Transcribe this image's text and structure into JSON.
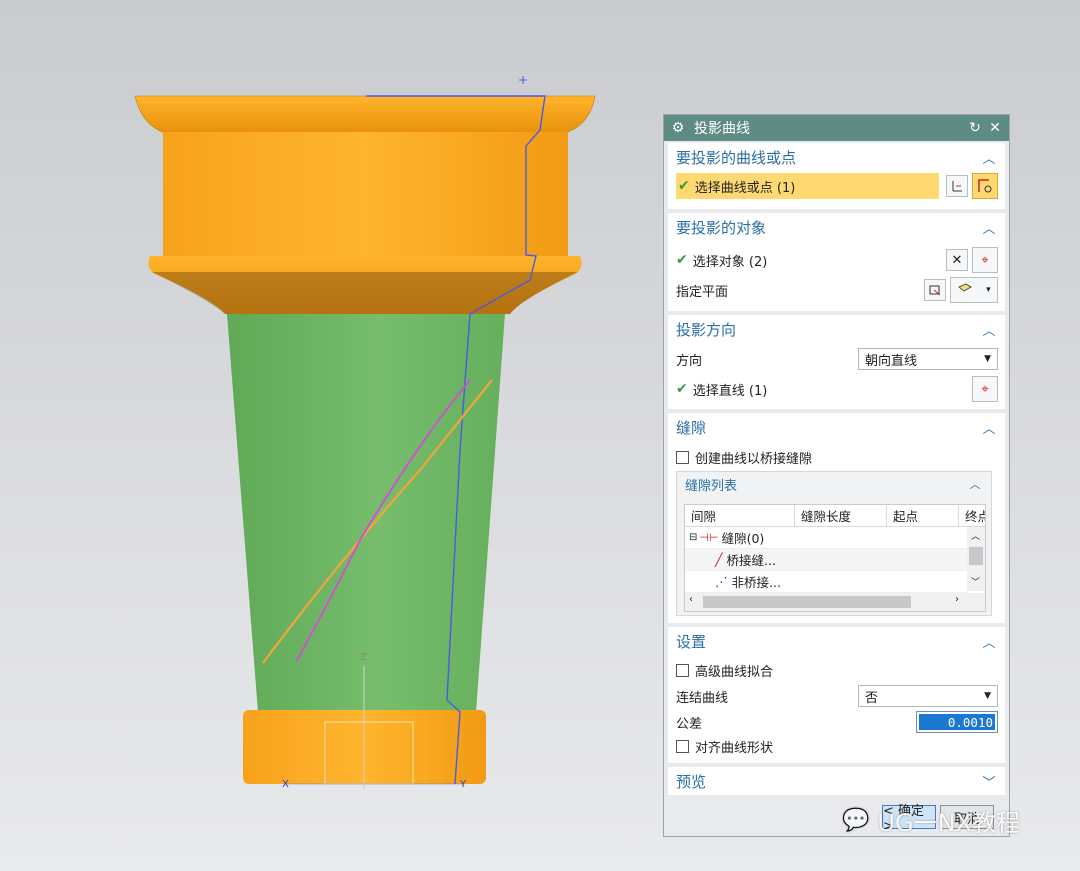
{
  "viewport": {
    "axis_labels": {
      "z": "Z",
      "x": "X",
      "y": "Y"
    },
    "colors": {
      "orange": "#f6a623",
      "green": "#6fb866",
      "blue_curve": "#4a5ae6",
      "magenta_curve": "#d64ad6",
      "orange_curve": "#f3a53c"
    }
  },
  "dialog": {
    "title": "投影曲线",
    "icons": {
      "gear": "gear-icon",
      "reset": "reset-icon",
      "close": "close-icon"
    },
    "groups": {
      "curves": {
        "title": "要投影的曲线或点",
        "select_label": "选择曲线或点 (1)"
      },
      "objects": {
        "title": "要投影的对象",
        "select_label": "选择对象 (2)",
        "plane_label": "指定平面"
      },
      "direction": {
        "title": "投影方向",
        "direction_label": "方向",
        "direction_value": "朝向直线",
        "select_line_label": "选择直线 (1)"
      },
      "gaps": {
        "title": "缝隙",
        "bridge_checkbox_label": "创建曲线以桥接缝隙",
        "list_title": "缝隙列表",
        "columns": [
          "间隙",
          "缝隙长度",
          "起点",
          "终点"
        ],
        "rows": [
          {
            "label": "缝隙(0)"
          },
          {
            "label": "桥接缝..."
          },
          {
            "label": "非桥接..."
          }
        ]
      },
      "settings": {
        "title": "设置",
        "advanced_fit_label": "高级曲线拟合",
        "join_label": "连结曲线",
        "join_value": "否",
        "tolerance_label": "公差",
        "tolerance_value": "0.0010",
        "align_label": "对齐曲线形状"
      },
      "preview": {
        "title": "预览"
      }
    },
    "buttons": {
      "ok": "< 确定 >",
      "cancel": "取消"
    }
  },
  "watermark": "UG一NX教程"
}
